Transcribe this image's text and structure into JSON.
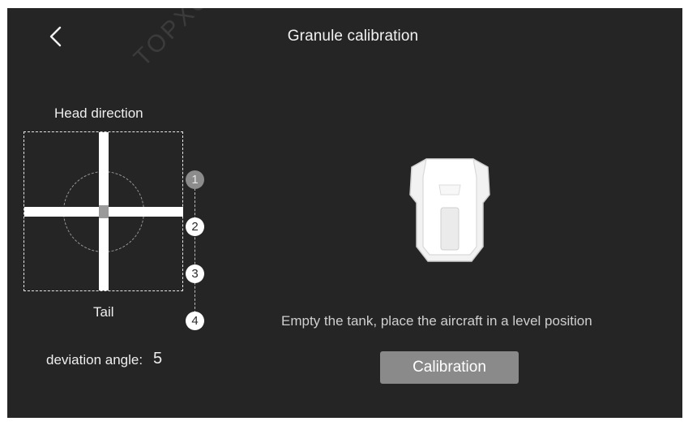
{
  "header": {
    "title": "Granule calibration",
    "back_icon": "chevron-left-icon"
  },
  "diagram": {
    "head_label": "Head direction",
    "tail_label": "Tail"
  },
  "levels": [
    "1",
    "2",
    "3",
    "4"
  ],
  "active_level": "1",
  "deviation": {
    "label": "deviation angle:",
    "value": "5"
  },
  "instruction": "Empty the tank, place the aircraft in a level position",
  "calibration_button": "Calibration",
  "watermark": "TOPXGUN (ANJ)",
  "colors": {
    "background": "#252525",
    "button": "#8a8a8a",
    "active_level": "#8c8c8c"
  }
}
